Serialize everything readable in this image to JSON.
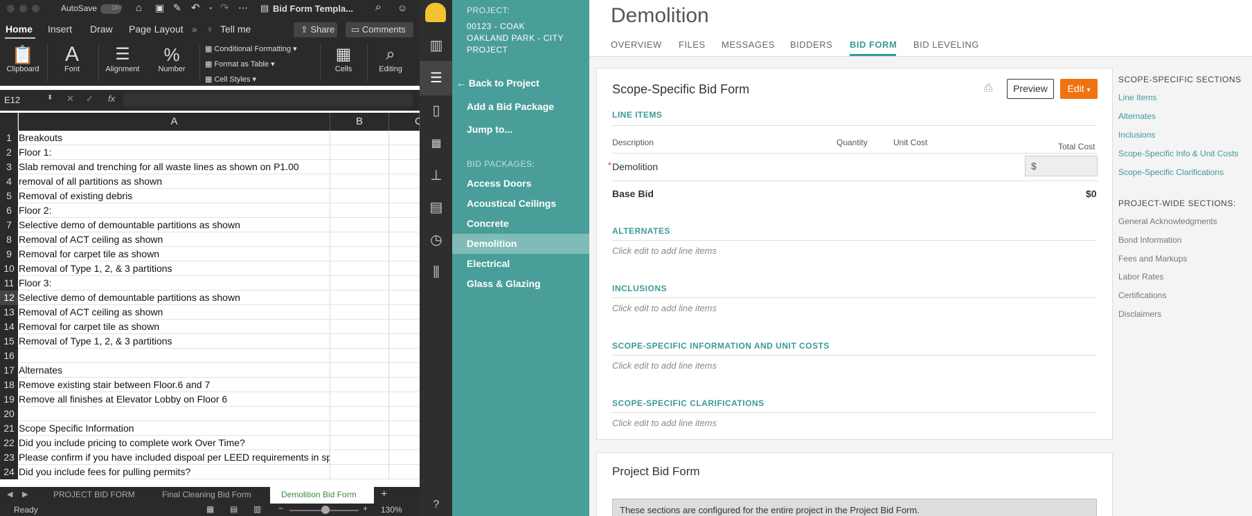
{
  "excel": {
    "title": "Bid Form Templa...",
    "autosave_label": "AutoSave",
    "autosave_state": "OFF",
    "ribbon_tabs": [
      "Home",
      "Insert",
      "Draw",
      "Page Layout",
      "Tell me"
    ],
    "share_label": "Share",
    "comments_label": "Comments",
    "ribbon": {
      "clipboard": "Clipboard",
      "font": "Font",
      "alignment": "Alignment",
      "number": "Number",
      "cond_format": "Conditional Formatting",
      "format_table": "Format as Table",
      "cell_styles": "Cell Styles",
      "cells": "Cells",
      "editing": "Editing"
    },
    "name_box": "E12",
    "fx_label": "fx",
    "columns": [
      "A",
      "B",
      "C"
    ],
    "rows": [
      {
        "n": "1",
        "a": "Breakouts"
      },
      {
        "n": "2",
        "a": "Floor 1:"
      },
      {
        "n": "3",
        "a": "Slab removal and trenching for all waste lines as shown on P1.00"
      },
      {
        "n": "4",
        "a": "removal of all partitions as shown"
      },
      {
        "n": "5",
        "a": "Removal of existing debris"
      },
      {
        "n": "6",
        "a": "Floor 2:"
      },
      {
        "n": "7",
        "a": "Selective demo of demountable partitions as shown"
      },
      {
        "n": "8",
        "a": "Removal of ACT ceiling as shown"
      },
      {
        "n": "9",
        "a": "Removal for carpet tile as shown"
      },
      {
        "n": "10",
        "a": "Removal of Type 1, 2, & 3 partitions"
      },
      {
        "n": "11",
        "a": "Floor 3:"
      },
      {
        "n": "12",
        "a": "Selective demo of demountable partitions as shown"
      },
      {
        "n": "13",
        "a": "Removal of ACT ceiling as shown"
      },
      {
        "n": "14",
        "a": "Removal for carpet tile as shown"
      },
      {
        "n": "15",
        "a": "Removal of Type 1, 2, & 3 partitions"
      },
      {
        "n": "16",
        "a": ""
      },
      {
        "n": "17",
        "a": "Alternates"
      },
      {
        "n": "18",
        "a": "Remove existing stair between Floor.6 and 7"
      },
      {
        "n": "19",
        "a": "Remove all finishes at Elevator Lobby on Floor 6"
      },
      {
        "n": "20",
        "a": ""
      },
      {
        "n": "21",
        "a": "Scope Specific Information"
      },
      {
        "n": "22",
        "a": "Did you include pricing to complete work Over Time?"
      },
      {
        "n": "23",
        "a": "Please confirm if you have included dispoal per LEED requirements in spec."
      },
      {
        "n": "24",
        "a": "Did you include fees for pulling permits?"
      }
    ],
    "sheet_tabs": [
      "PROJECT BID FORM",
      "Final Cleaning Bid Form",
      "Demolition Bid Form"
    ],
    "status_ready": "Ready",
    "zoom": "130%"
  },
  "nav": {
    "project_label": "PROJECT:",
    "project_name_1": "00123 - COAK",
    "project_name_2": "OAKLAND PARK - CITY",
    "project_name_3": "PROJECT",
    "back": "Back to Project",
    "add_package": "Add a Bid Package",
    "jump": "Jump to...",
    "packages_label": "BID PACKAGES:",
    "packages": [
      "Access Doors",
      "Acoustical Ceilings",
      "Concrete",
      "Demolition",
      "Electrical",
      "Glass & Glazing"
    ]
  },
  "main": {
    "title": "Demolition",
    "tabs": [
      "OVERVIEW",
      "FILES",
      "MESSAGES",
      "BIDDERS",
      "BID FORM",
      "BID LEVELING"
    ],
    "card_title": "Scope-Specific Bid Form",
    "preview": "Preview",
    "edit": "Edit",
    "line_items": "LINE ITEMS",
    "col_description": "Description",
    "col_quantity": "Quantity",
    "col_unit_cost": "Unit Cost",
    "col_total_cost": "Total Cost",
    "required_mark": "*",
    "item_demolition": "Demolition",
    "currency": "$",
    "base_bid": "Base Bid",
    "base_bid_value": "$0",
    "alternates": "ALTERNATES",
    "inclusions": "INCLUSIONS",
    "scope_info": "SCOPE-SPECIFIC INFORMATION AND UNIT COSTS",
    "scope_clar": "SCOPE-SPECIFIC CLARIFICATIONS",
    "empty_hint": "Click edit to add line items",
    "project_bid_form": "Project Bid Form",
    "project_note": "These sections are configured for the entire project in the Project Bid Form."
  },
  "side": {
    "scope_header": "SCOPE-SPECIFIC SECTIONS",
    "scope_links": [
      "Line Items",
      "Alternates",
      "Inclusions",
      "Scope-Specific Info & Unit Costs",
      "Scope-Specific Clarifications"
    ],
    "project_header": "PROJECT-WIDE SECTIONS:",
    "project_links": [
      "General Acknowledgments",
      "Bond Information",
      "Fees and Markups",
      "Labor Rates",
      "Certifications",
      "Disclaimers"
    ]
  },
  "colors": {
    "teal": "#4a9e9a",
    "accent": "#3a9a96",
    "edit_orange": "#f0720f"
  }
}
